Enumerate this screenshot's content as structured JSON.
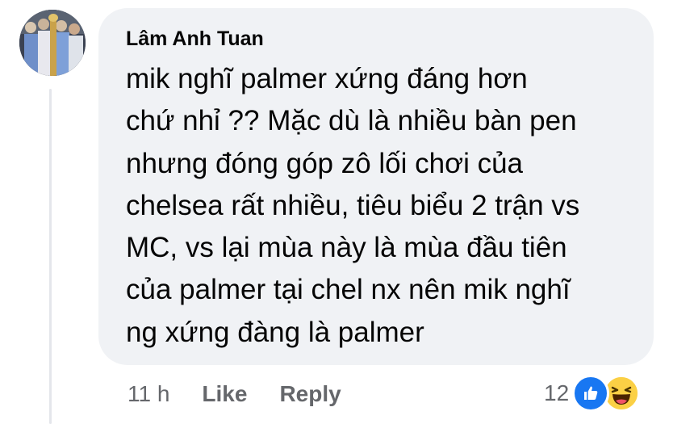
{
  "comment": {
    "author": "Lâm Anh Tuan",
    "text": "mik nghĩ palmer xứng đáng hơn\nchứ nhỉ ?? Mặc dù là nhiều bàn pen\nnhưng đóng góp zô lối chơi của\nchelsea rất nhiều, tiêu biểu 2 trận vs\nMC, vs lại mùa này là mùa đầu tiên\ncủa palmer tại chel nx nên mik nghĩ\nng xứng đàng là palmer",
    "timestamp": "11 h",
    "like_label": "Like",
    "reply_label": "Reply",
    "reaction_count": "12",
    "reactions": [
      "like-icon",
      "haha-icon"
    ]
  },
  "colors": {
    "bubble_bg": "#f0f2f5",
    "text": "#050505",
    "meta_text": "#65676b",
    "like_blue": "#1877f2",
    "haha_yellow": "#fbd045"
  }
}
